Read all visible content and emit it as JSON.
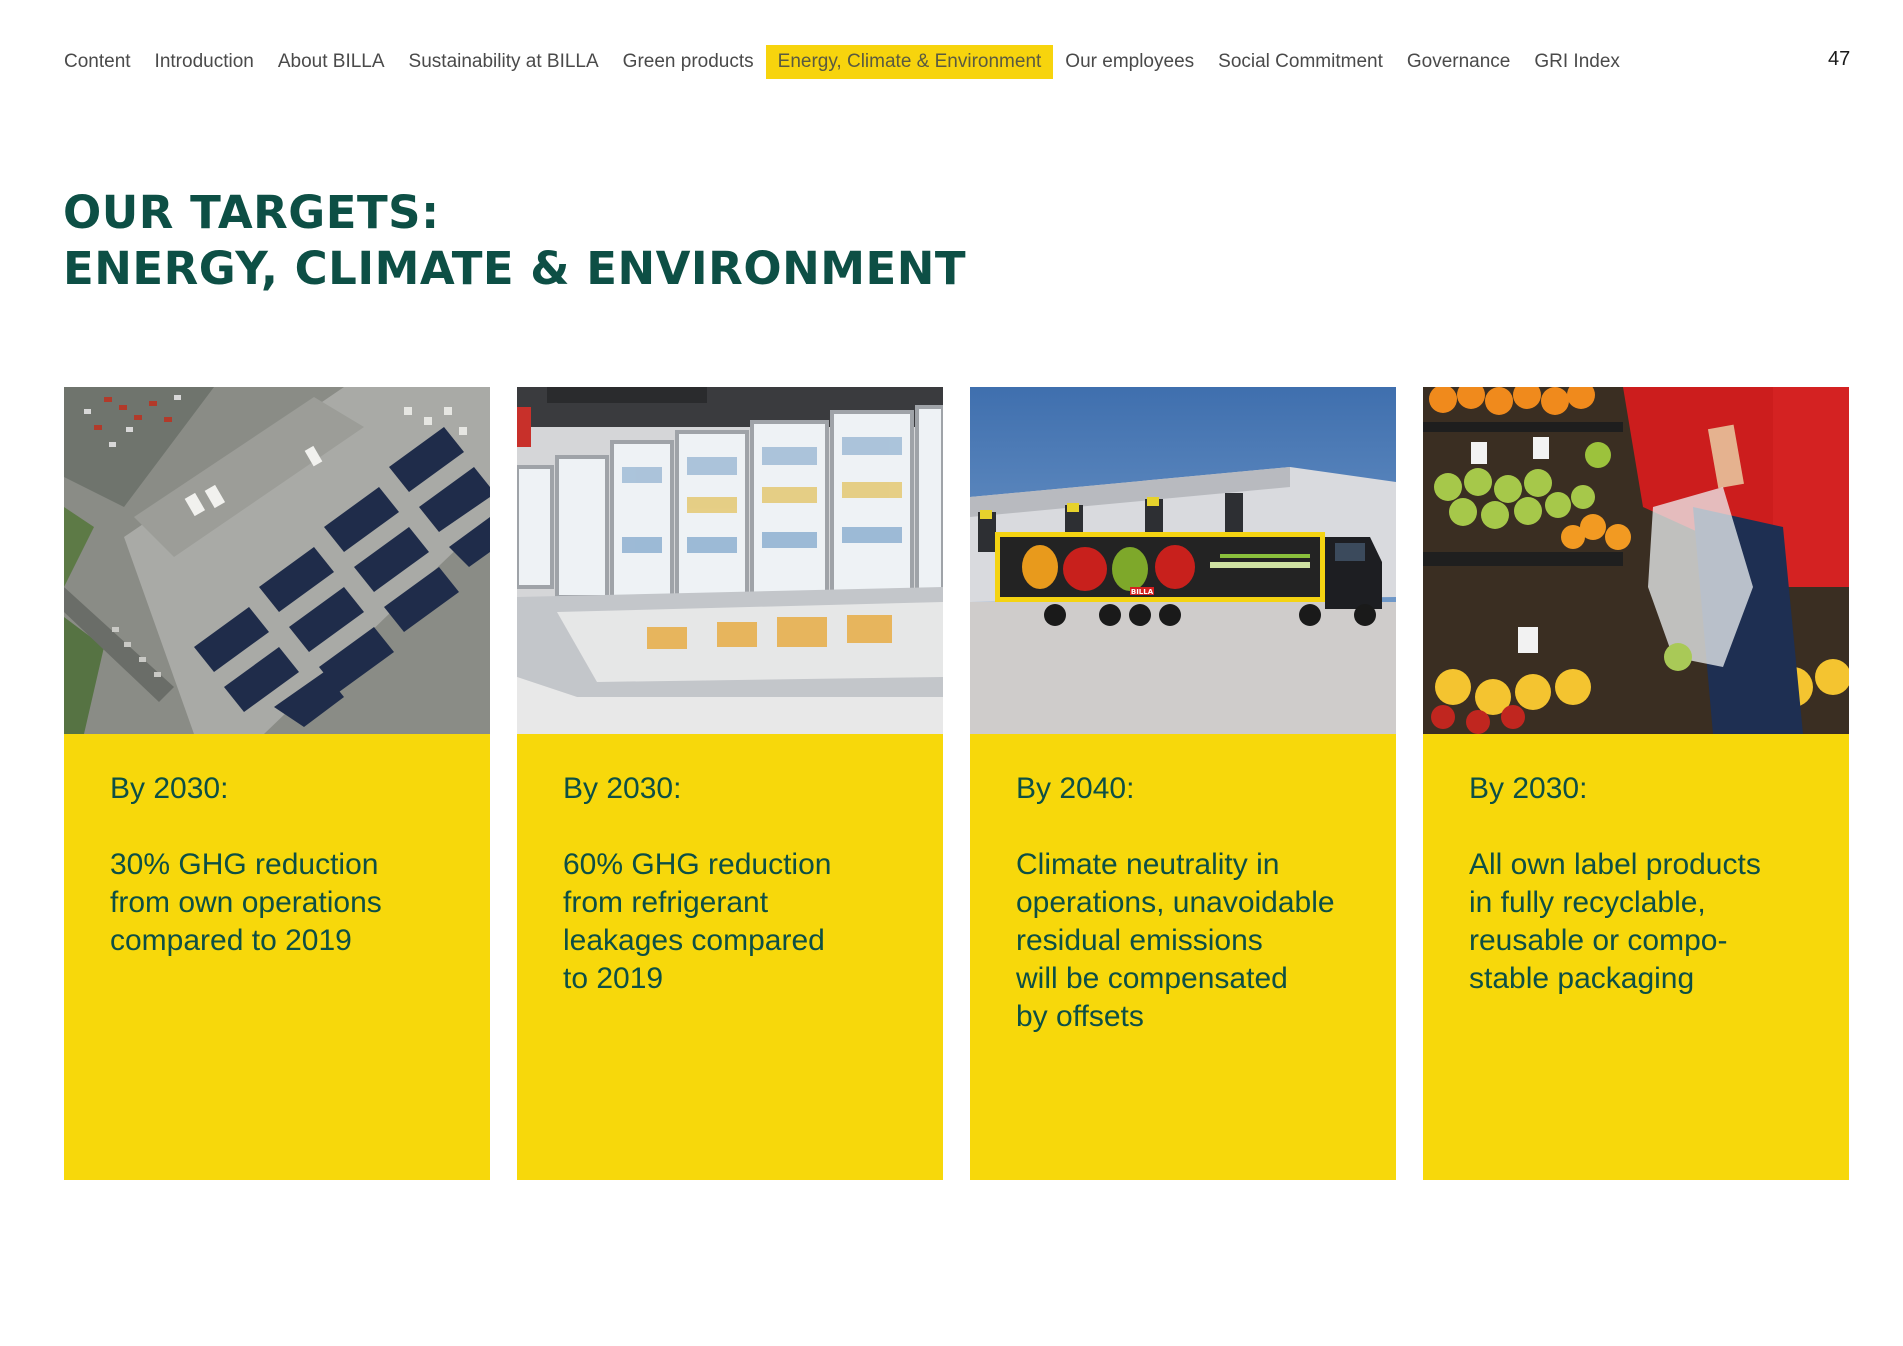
{
  "nav": {
    "items": [
      {
        "label": "Content"
      },
      {
        "label": "Introduction"
      },
      {
        "label": "About BILLA"
      },
      {
        "label": "Sustainability at BILLA"
      },
      {
        "label": "Green products"
      },
      {
        "label": "Energy, Climate & Environment",
        "active": true
      },
      {
        "label": "Our employees"
      },
      {
        "label": "Social Commitment"
      },
      {
        "label": "Governance"
      },
      {
        "label": "GRI Index"
      }
    ],
    "page_number": "47"
  },
  "title": {
    "line1": "OUR TARGETS:",
    "line2": "ENERGY, CLIMATE & ENVIRONMENT"
  },
  "cards": [
    {
      "photo": "aerial-solar-roof-photo",
      "year": "By 2030:",
      "text": "30% GHG reduction\nfrom own operations\ncompared to 2019"
    },
    {
      "photo": "refrigerated-display-cases-photo",
      "year": "By 2030:",
      "text": "60% GHG reduction\nfrom refrigerant\nleakages compared\nto 2019"
    },
    {
      "photo": "billa-delivery-truck-photo",
      "year": "By 2040:",
      "text": "Climate neutrality in\noperations, unavoidable\nresidual emissions\nwill be compensated\nby offsets",
      "truck_label": "BILLA"
    },
    {
      "photo": "produce-shopper-reusable-bag-photo",
      "year": "By 2030:",
      "text": "All own label products\nin fully recyclable,\nreusable or compo-\nstable packaging"
    }
  ],
  "colors": {
    "accent_yellow": "#f7d80b",
    "title_green": "#0d4f45"
  }
}
